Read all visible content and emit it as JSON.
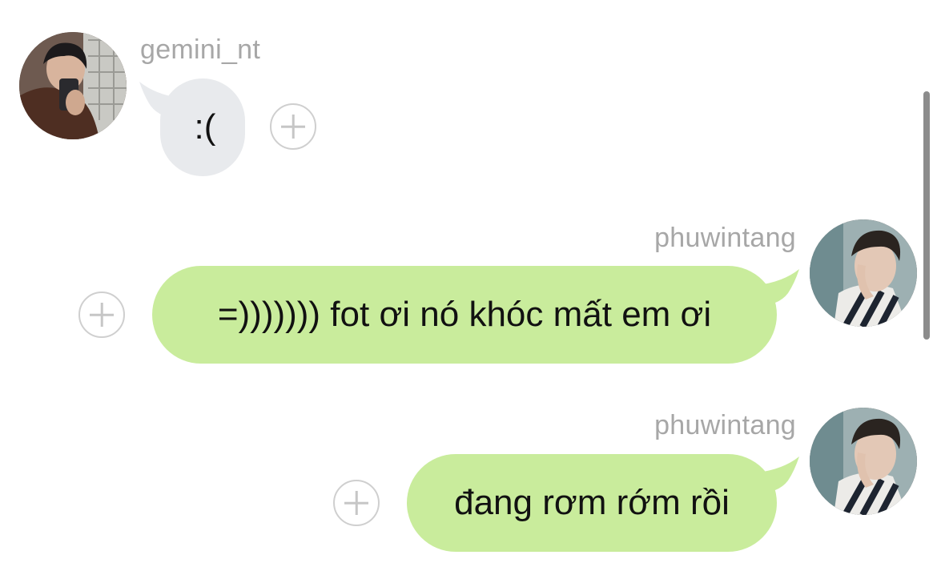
{
  "messages": [
    {
      "sender": "gemini_nt",
      "direction": "incoming",
      "text": ":(",
      "avatar_icon": "profile-photo-gemini"
    },
    {
      "sender": "phuwintang",
      "direction": "outgoing",
      "text": "=))))))) fot ơi nó khóc mất em ơi",
      "avatar_icon": "profile-photo-phuwintang"
    },
    {
      "sender": "phuwintang",
      "direction": "outgoing",
      "text": "đang rơm rớm rồi",
      "avatar_icon": "profile-photo-phuwintang"
    }
  ],
  "colors": {
    "incoming_bubble": "#e8eaed",
    "outgoing_bubble": "#c9ec9c",
    "username": "#a7a7a7",
    "add_reaction_icon": "#c6c6c6"
  },
  "icons": {
    "add_reaction": "plus-circle-icon"
  }
}
